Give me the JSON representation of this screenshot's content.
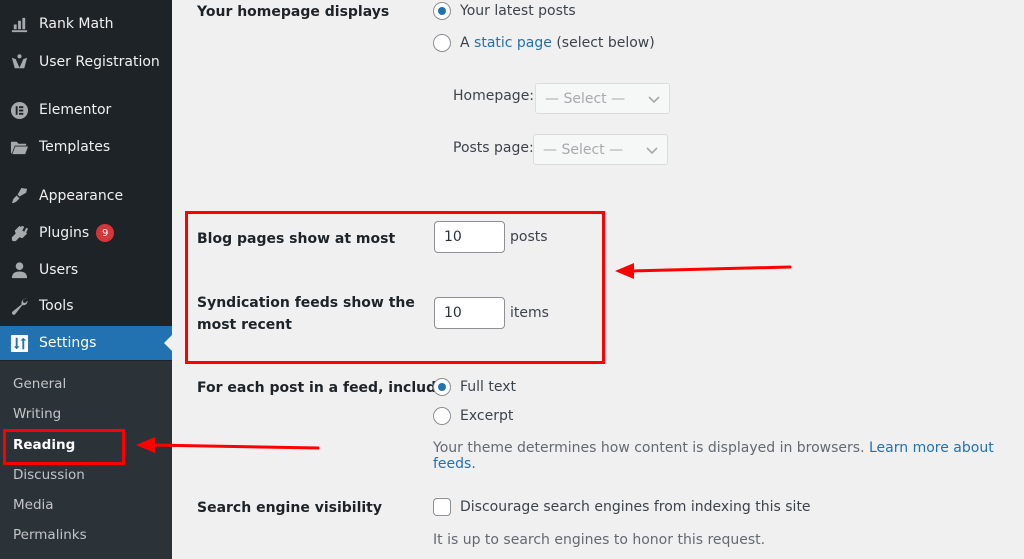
{
  "sidebar": {
    "items": [
      {
        "label": "Rank Math",
        "icon": "rank-math-icon"
      },
      {
        "label": "User Registration",
        "icon": "user-registration-icon"
      },
      {
        "label": "Elementor",
        "icon": "elementor-icon"
      },
      {
        "label": "Templates",
        "icon": "folder-icon"
      },
      {
        "label": "Appearance",
        "icon": "paintbrush-icon"
      },
      {
        "label": "Plugins",
        "icon": "plug-icon",
        "badge": "9"
      },
      {
        "label": "Users",
        "icon": "user-icon"
      },
      {
        "label": "Tools",
        "icon": "wrench-icon"
      },
      {
        "label": "Settings",
        "icon": "settings-icon",
        "active": true
      }
    ],
    "submenu": [
      {
        "label": "General"
      },
      {
        "label": "Writing"
      },
      {
        "label": "Reading",
        "current": true
      },
      {
        "label": "Discussion"
      },
      {
        "label": "Media"
      },
      {
        "label": "Permalinks"
      }
    ]
  },
  "settings": {
    "homepage": {
      "label": "Your homepage displays",
      "option_latest": "Your latest posts",
      "option_static_prefix": "A",
      "option_static_link": "static page",
      "option_static_suffix": "(select below)",
      "selected": "latest",
      "homepage_label": "Homepage:",
      "homepage_select": "— Select —",
      "posts_page_label": "Posts page:",
      "posts_page_select": "— Select —"
    },
    "blog_pages": {
      "label": "Blog pages show at most",
      "value": "10",
      "unit": "posts"
    },
    "syndication": {
      "label_line1": "Syndication feeds show the",
      "label_line2": "most recent",
      "value": "10",
      "unit": "items"
    },
    "feed_content": {
      "label": "For each post in a feed, include",
      "option_full": "Full text",
      "option_excerpt": "Excerpt",
      "selected": "full",
      "description": "Your theme determines how content is displayed in browsers.",
      "link": "Learn more about feeds."
    },
    "search_visibility": {
      "label": "Search engine visibility",
      "checkbox_label": "Discourage search engines from indexing this site",
      "checked": false,
      "description": "It is up to search engines to honor this request."
    }
  },
  "annotations": {
    "color": "#ff0000"
  }
}
